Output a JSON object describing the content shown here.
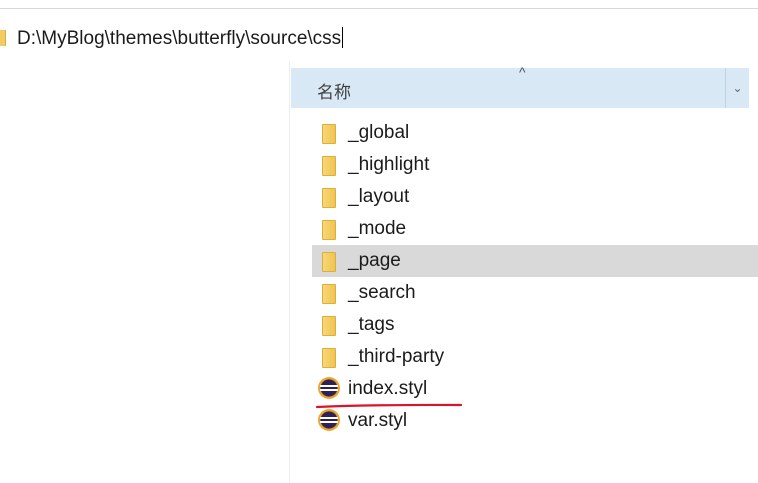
{
  "address_bar": {
    "path": "D:\\MyBlog\\themes\\butterfly\\source\\css"
  },
  "column_header": {
    "name_label": "名称",
    "sort_indicator": "^",
    "dropdown_glyph": "⌄"
  },
  "files": [
    {
      "name": "_global",
      "type": "folder"
    },
    {
      "name": "_highlight",
      "type": "folder"
    },
    {
      "name": "_layout",
      "type": "folder"
    },
    {
      "name": "_mode",
      "type": "folder"
    },
    {
      "name": "_page",
      "type": "folder",
      "selected": true
    },
    {
      "name": "_search",
      "type": "folder"
    },
    {
      "name": "_tags",
      "type": "folder"
    },
    {
      "name": "_third-party",
      "type": "folder"
    },
    {
      "name": "index.styl",
      "type": "file",
      "annotated": true
    },
    {
      "name": "var.styl",
      "type": "file"
    }
  ],
  "colors": {
    "header_bg": "#d9e8f5",
    "selected_row_bg": "#d9d9d9",
    "annotation": "#d9142b",
    "folder": "#f2c350"
  }
}
